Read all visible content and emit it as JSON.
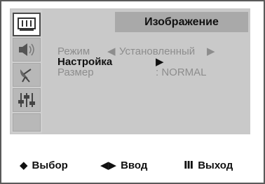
{
  "menu": {
    "title": "Изображение",
    "sidebar_icons": [
      "picture-icon",
      "sound-icon",
      "channel-icon",
      "setup-icon"
    ],
    "items": [
      {
        "label": "Режим",
        "left_arrow": "◀",
        "value": "Установленный",
        "right_arrow": "▶"
      },
      {
        "label": "Настройка",
        "value": "▶"
      },
      {
        "label": "Размер",
        "value": ": NORMAL"
      }
    ]
  },
  "footer": {
    "select_icon": "◆",
    "select_label": "Выбор",
    "enter_icon": "◀▶",
    "enter_label": "Ввод",
    "exit_icon": "Ⅲ",
    "exit_label": "Выход"
  }
}
